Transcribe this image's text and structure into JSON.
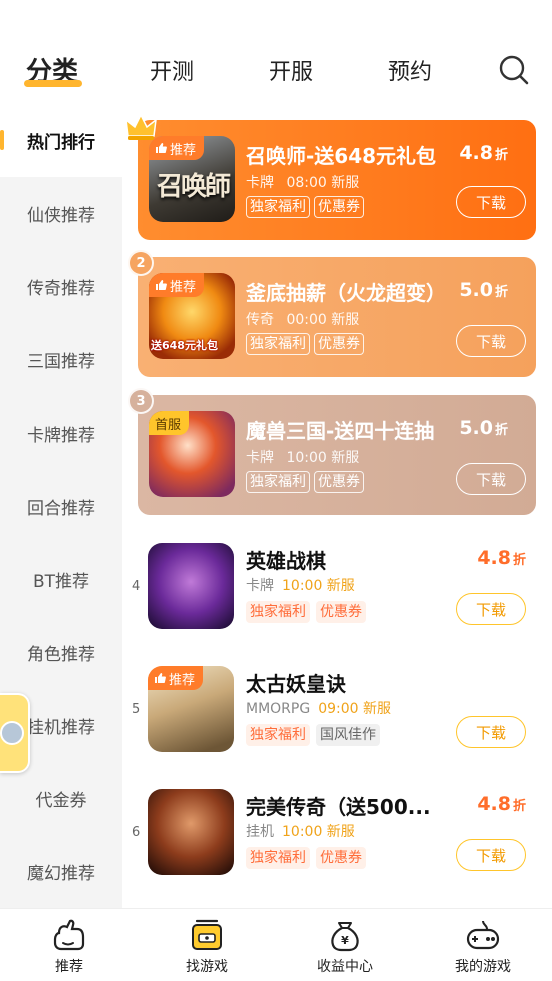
{
  "top_tabs": [
    {
      "label": "分类"
    },
    {
      "label": "开测"
    },
    {
      "label": "开服"
    },
    {
      "label": "预约"
    }
  ],
  "sidebar": {
    "items": [
      {
        "label": "热门排行"
      },
      {
        "label": "仙侠推荐"
      },
      {
        "label": "传奇推荐"
      },
      {
        "label": "三国推荐"
      },
      {
        "label": "卡牌推荐"
      },
      {
        "label": "回合推荐"
      },
      {
        "label": "BT推荐"
      },
      {
        "label": "角色推荐"
      },
      {
        "label": "挂机推荐"
      },
      {
        "label": "代金券"
      },
      {
        "label": "魔幻推荐"
      }
    ]
  },
  "games": [
    {
      "rank": "1",
      "title": "召唤师-送648元礼包",
      "category": "卡牌",
      "time": "08:00 新服",
      "tags": [
        "独家福利",
        "优惠券"
      ],
      "discount": "4.8",
      "discount_unit": "折",
      "button": "下载",
      "corner": "推荐",
      "icon_text": "召唤師"
    },
    {
      "rank": "2",
      "title": "釜底抽薪（火龙超变）",
      "category": "传奇",
      "time": "00:00 新服",
      "tags": [
        "独家福利",
        "优惠券"
      ],
      "discount": "5.0",
      "discount_unit": "折",
      "button": "下载",
      "corner": "推荐",
      "icon_text": "送648元礼包"
    },
    {
      "rank": "3",
      "title": "魔兽三国-送四十连抽",
      "category": "卡牌",
      "time": "10:00 新服",
      "tags": [
        "独家福利",
        "优惠券"
      ],
      "discount": "5.0",
      "discount_unit": "折",
      "button": "下载",
      "corner": "首服"
    },
    {
      "rank": "4",
      "title": "英雄战棋",
      "category": "卡牌",
      "time": "10:00 新服",
      "tags": [
        "独家福利",
        "优惠券"
      ],
      "discount": "4.8",
      "discount_unit": "折",
      "button": "下载"
    },
    {
      "rank": "5",
      "title": "太古妖皇诀",
      "category": "MMORPG",
      "time": "09:00 新服",
      "tags": [
        "独家福利",
        "国风佳作"
      ],
      "button": "下载",
      "corner": "推荐"
    },
    {
      "rank": "6",
      "title": "完美传奇（送500...",
      "category": "挂机",
      "time": "10:00 新服",
      "tags": [
        "独家福利",
        "优惠券"
      ],
      "discount": "4.8",
      "discount_unit": "折",
      "button": "下载"
    }
  ],
  "bottom_nav": [
    {
      "label": "推荐"
    },
    {
      "label": "找游戏"
    },
    {
      "label": "收益中心"
    },
    {
      "label": "我的游戏"
    }
  ],
  "colors": {
    "accent": "#ffb52e",
    "card1": "#ff7a1f",
    "card2": "#f7a566",
    "card3": "#d8b29e",
    "discount_orange": "#ff6d2a"
  }
}
